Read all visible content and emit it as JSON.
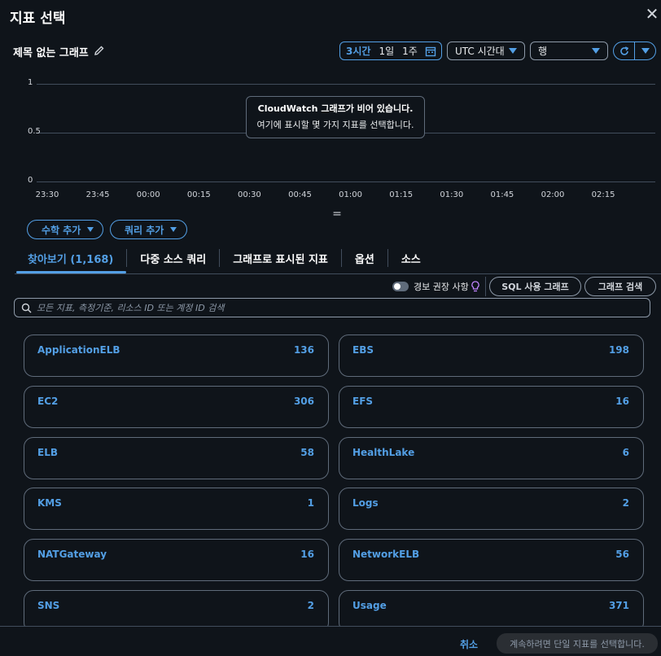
{
  "modal": {
    "title": "지표 선택",
    "close_icon": "close-icon"
  },
  "graph": {
    "title": "제목 없는 그래프"
  },
  "time_range": {
    "options": [
      "3시간",
      "1일",
      "1주"
    ],
    "selected": "3시간"
  },
  "timezone": {
    "value": "UTC 시간대"
  },
  "view": {
    "value": "행"
  },
  "chart_data": {
    "type": "line",
    "title": "",
    "x": [
      "23:30",
      "23:45",
      "00:00",
      "00:15",
      "00:30",
      "00:45",
      "01:00",
      "01:15",
      "01:30",
      "01:45",
      "02:00",
      "02:15"
    ],
    "yticks": [
      "1",
      "0.5",
      "0"
    ],
    "ylim": [
      0,
      1
    ],
    "series": [],
    "grid": true,
    "empty_message_title": "CloudWatch 그래프가 비어 있습니다.",
    "empty_message_body": "여기에 표시할 몇 가지 지표를 선택합니다."
  },
  "resize_handle": "=",
  "actions": {
    "add_math": "수학 추가",
    "add_query": "쿼리 추가"
  },
  "tabs": [
    {
      "label": "찾아보기 (1,168)",
      "active": true
    },
    {
      "label": "다중 소스 쿼리"
    },
    {
      "label": "그래프로 표시된 지표"
    },
    {
      "label": "옵션"
    },
    {
      "label": "소스"
    }
  ],
  "toolbar": {
    "alarm_toggle_label": "경보 권장 사항",
    "sql_button": "SQL 사용 그래프",
    "search_graph_button": "그래프 검색"
  },
  "search": {
    "placeholder": "모든 지표, 측정기준, 리소스 ID 또는 계정 ID 검색"
  },
  "namespaces": [
    {
      "name": "ApplicationELB",
      "count": "136"
    },
    {
      "name": "EBS",
      "count": "198"
    },
    {
      "name": "EC2",
      "count": "306"
    },
    {
      "name": "EFS",
      "count": "16"
    },
    {
      "name": "ELB",
      "count": "58"
    },
    {
      "name": "HealthLake",
      "count": "6"
    },
    {
      "name": "KMS",
      "count": "1"
    },
    {
      "name": "Logs",
      "count": "2"
    },
    {
      "name": "NATGateway",
      "count": "16"
    },
    {
      "name": "NetworkELB",
      "count": "56"
    },
    {
      "name": "SNS",
      "count": "2"
    },
    {
      "name": "Usage",
      "count": "371"
    }
  ],
  "footer": {
    "cancel": "취소",
    "continue": "계속하려면 단일 지표를 선택합니다."
  },
  "colors": {
    "accent": "#539fe5",
    "background": "#0f141a",
    "border": "#5f6b7a"
  }
}
